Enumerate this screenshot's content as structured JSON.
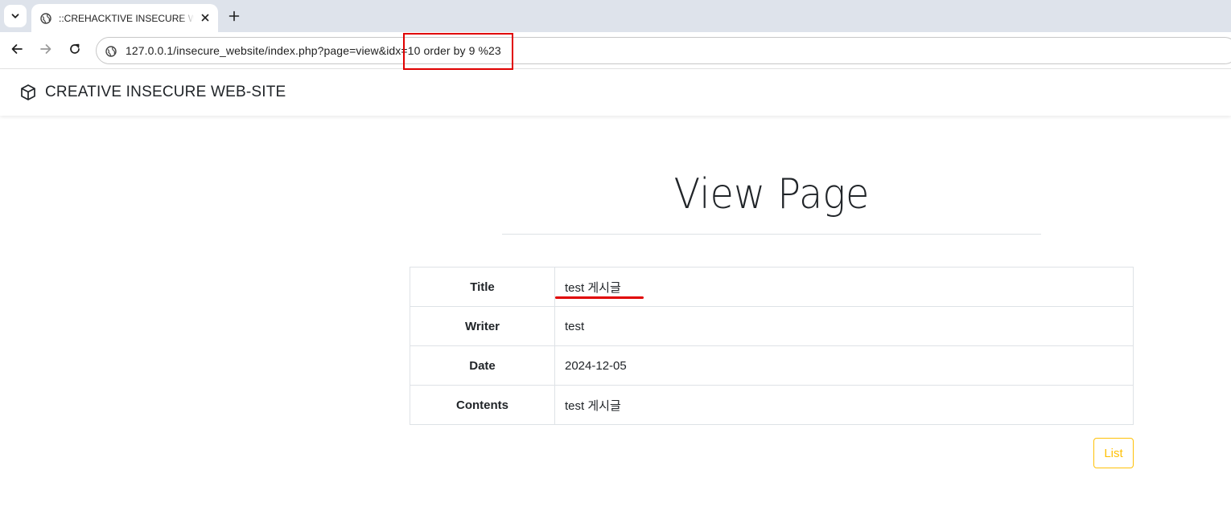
{
  "browser": {
    "tab_title": "::CREHACKTIVE INSECURE WEB-SITE",
    "url": "127.0.0.1/insecure_website/index.php?page=view&idx=10 order by 9 %23"
  },
  "site": {
    "brand": "CREATIVE INSECURE WEB-SITE"
  },
  "page": {
    "heading": "View Page",
    "rows": [
      {
        "label": "Title",
        "value": "test 게시글"
      },
      {
        "label": "Writer",
        "value": "test"
      },
      {
        "label": "Date",
        "value": "2024-12-05"
      },
      {
        "label": "Contents",
        "value": "test 게시글"
      }
    ],
    "list_button": "List"
  },
  "colors": {
    "annotation": "#e00000",
    "list_button": "#ffc107"
  }
}
